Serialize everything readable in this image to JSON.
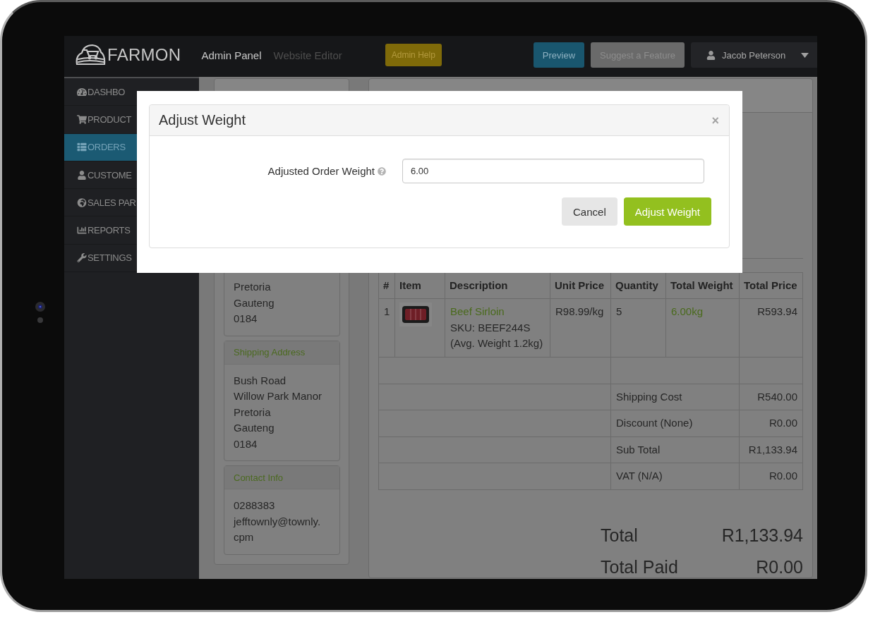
{
  "navbar": {
    "brand": "FARMON",
    "links": [
      {
        "label": "Admin Panel",
        "selected": true
      },
      {
        "label": "Website Editor",
        "selected": false
      }
    ],
    "help_button": "Admin Help",
    "actions": [
      {
        "label": "Preview",
        "kind": "info"
      },
      {
        "label": "Suggest a Feature",
        "kind": "muted"
      }
    ],
    "user": "Jacob Peterson"
  },
  "sidebar": {
    "items": [
      {
        "label": "DASHBO",
        "selected": false
      },
      {
        "label": "PRODUCT",
        "selected": false
      },
      {
        "label": "ORDERS",
        "selected": true
      },
      {
        "label": "CUSTOME",
        "selected": false
      },
      {
        "label": "SALES PAR",
        "selected": false
      },
      {
        "label": "REPORTS",
        "selected": false
      },
      {
        "label": "SETTINGS",
        "selected": false
      }
    ]
  },
  "customer_panel": {
    "cards": [
      {
        "lines": [
          "Pretoria",
          "Gauteng",
          "0184"
        ]
      },
      {
        "title": "Shipping Address",
        "lines": [
          "Bush Road",
          "Willow Park Manor",
          "Pretoria",
          "Gauteng",
          "0184"
        ]
      },
      {
        "title": "Contact Info",
        "lines": [
          "0288383",
          "jefftownly@townly.cpm"
        ]
      }
    ]
  },
  "order_panel": {
    "table": {
      "columns": [
        "#",
        "Item",
        "Description",
        "Unit Price",
        "Quantity",
        "Total Weight",
        "Total Price"
      ],
      "rows": [
        {
          "number": "1",
          "name": "Beef Sirloin",
          "sku": "SKU: BEEF244S",
          "note": "(Avg. Weight 1.2kg)",
          "unit_price": "R98.99/kg",
          "quantity": "5",
          "total_weight": "6.00kg",
          "total_price": "R593.94"
        }
      ],
      "summary": [
        {
          "label": "Shipping Cost",
          "value": "R540.00"
        },
        {
          "label": "Discount (None)",
          "value": "R0.00"
        },
        {
          "label": "Sub Total",
          "value": "R1,133.94"
        },
        {
          "label": "VAT (N/A)",
          "value": "R0.00"
        }
      ]
    },
    "totals": [
      {
        "label": "Total",
        "value": "R1,133.94"
      },
      {
        "label": "Total Paid",
        "value": "R0.00"
      }
    ]
  },
  "modal": {
    "title": "Adjust Weight",
    "close": "×",
    "field": {
      "label": "Adjusted Order Weight",
      "value": "6.00"
    },
    "buttons": [
      {
        "label": "Cancel",
        "kind": "default"
      },
      {
        "label": "Adjust Weight",
        "kind": "primary"
      }
    ]
  }
}
